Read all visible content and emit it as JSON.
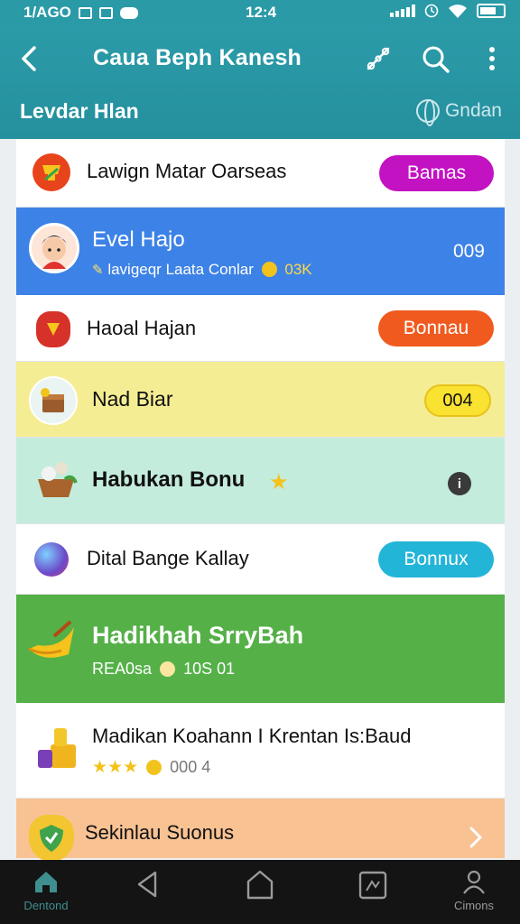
{
  "status_bar": {
    "date": "1/AGO",
    "time": "12:4"
  },
  "app_bar": {
    "title": "Caua Beph Kanesh",
    "subtitle": "Levdar Hlan",
    "subtitle_action": "Gndan"
  },
  "list": [
    {
      "title": "Lawign Matar Oarseas",
      "button": "Bamas",
      "button_color": "#c212c2"
    },
    {
      "title": "Evel Hajo",
      "subtitle": "lavigeqr Laata Conlar",
      "subtitle_value": "03K",
      "value": "009"
    },
    {
      "title": "Haoal Hajan",
      "button": "Bonnau",
      "button_color": "#f05a1f"
    },
    {
      "title": "Nad Biar",
      "badge": "004"
    },
    {
      "title": "Habukan Bonu"
    },
    {
      "title": "Dital Bange Kallay",
      "button": "Bonnux",
      "button_color": "#23b5d8"
    },
    {
      "title": "Hadikhah SrryBah",
      "subtitle": "REA0sa",
      "subtitle_value": "10S 01"
    },
    {
      "title": "Madikan Koahann I Krentan Is:Baud",
      "rating_value": "000 4",
      "stars": 3
    },
    {
      "title": "Sekinlau Suonus"
    }
  ],
  "bottom_nav": {
    "home_label": "Dentond",
    "profile_label": "Cimons"
  },
  "colors": {
    "app_bar": "#2a9aa7",
    "blue_row": "#3d82e6",
    "yellow_row": "#f5ed93",
    "mint_row": "#c4ecdd",
    "green_row": "#54b047",
    "peach_row": "#f8c293"
  },
  "icons": [
    "back-arrow-icon",
    "link-icon",
    "search-icon",
    "more-vert-icon",
    "globe-icon",
    "home-icon",
    "triangle-back-icon",
    "home-outline-icon",
    "recent-apps-icon",
    "profile-icon"
  ]
}
